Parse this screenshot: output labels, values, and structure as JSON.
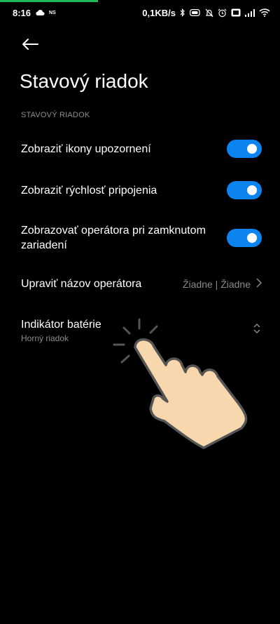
{
  "status_bar": {
    "time": "8:16",
    "left_badge": "NS",
    "speed": "0,1KB/s"
  },
  "header": {
    "title": "Stavový riadok"
  },
  "section": {
    "label": "STAVOVÝ RIADOK"
  },
  "settings": {
    "notifications_icons": {
      "label": "Zobraziť ikony upozornení",
      "enabled": true
    },
    "connection_speed": {
      "label": "Zobraziť rýchlosť pripojenia",
      "enabled": true
    },
    "lock_operator": {
      "label": "Zobrazovať operátora pri zamknutom zariadení",
      "enabled": true
    },
    "operator_name": {
      "label": "Upraviť názov operátora",
      "value": "Žiadne | Žiadne"
    },
    "battery_indicator": {
      "label": "Indikátor batérie",
      "value": "Horný riadok"
    }
  },
  "colors": {
    "accent": "#0b84f0",
    "background": "#000000",
    "secondary_text": "#8c8c8c",
    "progress": "#1db954"
  },
  "icons": {
    "back": "arrow-left-icon",
    "chevron": "chevron-right-icon",
    "updown": "chevron-up-down-icon",
    "hand": "tap-hand-icon"
  }
}
